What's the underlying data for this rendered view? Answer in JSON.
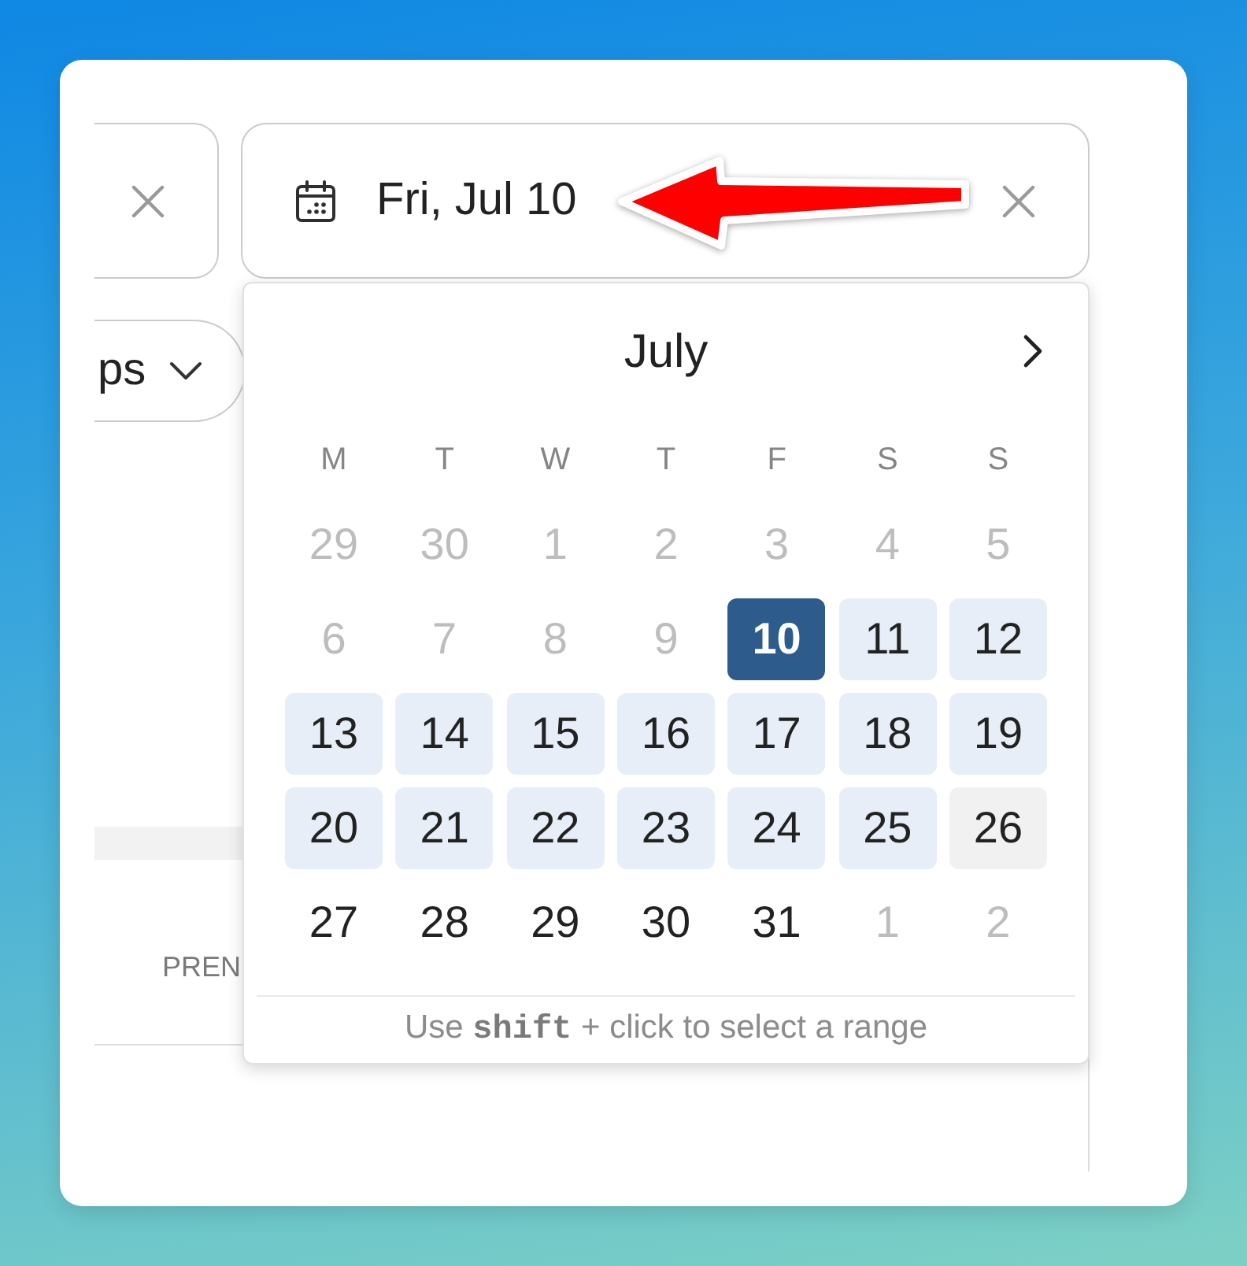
{
  "filters": [
    {
      "kind": "clipped",
      "clearable": true
    },
    {
      "kind": "date",
      "value": "Fri, Jul 10",
      "clearable": true
    }
  ],
  "date_picker": {
    "month": "July",
    "weekdays": [
      "M",
      "T",
      "W",
      "T",
      "F",
      "S",
      "S"
    ],
    "days": [
      {
        "label": "29",
        "disabled": true,
        "selected": false,
        "in_range": false,
        "hovered": false
      },
      {
        "label": "30",
        "disabled": true,
        "selected": false,
        "in_range": false,
        "hovered": false
      },
      {
        "label": "1",
        "disabled": true,
        "selected": false,
        "in_range": false,
        "hovered": false
      },
      {
        "label": "2",
        "disabled": true,
        "selected": false,
        "in_range": false,
        "hovered": false
      },
      {
        "label": "3",
        "disabled": true,
        "selected": false,
        "in_range": false,
        "hovered": false
      },
      {
        "label": "4",
        "disabled": true,
        "selected": false,
        "in_range": false,
        "hovered": false
      },
      {
        "label": "5",
        "disabled": true,
        "selected": false,
        "in_range": false,
        "hovered": false
      },
      {
        "label": "6",
        "disabled": true,
        "selected": false,
        "in_range": false,
        "hovered": false
      },
      {
        "label": "7",
        "disabled": true,
        "selected": false,
        "in_range": false,
        "hovered": false
      },
      {
        "label": "8",
        "disabled": true,
        "selected": false,
        "in_range": false,
        "hovered": false
      },
      {
        "label": "9",
        "disabled": true,
        "selected": false,
        "in_range": false,
        "hovered": false
      },
      {
        "label": "10",
        "disabled": false,
        "selected": true,
        "in_range": false,
        "hovered": false
      },
      {
        "label": "11",
        "disabled": false,
        "selected": false,
        "in_range": true,
        "hovered": false
      },
      {
        "label": "12",
        "disabled": false,
        "selected": false,
        "in_range": true,
        "hovered": false
      },
      {
        "label": "13",
        "disabled": false,
        "selected": false,
        "in_range": true,
        "hovered": false
      },
      {
        "label": "14",
        "disabled": false,
        "selected": false,
        "in_range": true,
        "hovered": false
      },
      {
        "label": "15",
        "disabled": false,
        "selected": false,
        "in_range": true,
        "hovered": false
      },
      {
        "label": "16",
        "disabled": false,
        "selected": false,
        "in_range": true,
        "hovered": false
      },
      {
        "label": "17",
        "disabled": false,
        "selected": false,
        "in_range": true,
        "hovered": false
      },
      {
        "label": "18",
        "disabled": false,
        "selected": false,
        "in_range": true,
        "hovered": false
      },
      {
        "label": "19",
        "disabled": false,
        "selected": false,
        "in_range": true,
        "hovered": false
      },
      {
        "label": "20",
        "disabled": false,
        "selected": false,
        "in_range": true,
        "hovered": false
      },
      {
        "label": "21",
        "disabled": false,
        "selected": false,
        "in_range": true,
        "hovered": false
      },
      {
        "label": "22",
        "disabled": false,
        "selected": false,
        "in_range": true,
        "hovered": false
      },
      {
        "label": "23",
        "disabled": false,
        "selected": false,
        "in_range": true,
        "hovered": false
      },
      {
        "label": "24",
        "disabled": false,
        "selected": false,
        "in_range": true,
        "hovered": false
      },
      {
        "label": "25",
        "disabled": false,
        "selected": false,
        "in_range": true,
        "hovered": false
      },
      {
        "label": "26",
        "disabled": false,
        "selected": false,
        "in_range": false,
        "hovered": true
      },
      {
        "label": "27",
        "disabled": false,
        "selected": false,
        "in_range": false,
        "hovered": false
      },
      {
        "label": "28",
        "disabled": false,
        "selected": false,
        "in_range": false,
        "hovered": false
      },
      {
        "label": "29",
        "disabled": false,
        "selected": false,
        "in_range": false,
        "hovered": false
      },
      {
        "label": "30",
        "disabled": false,
        "selected": false,
        "in_range": false,
        "hovered": false
      },
      {
        "label": "31",
        "disabled": false,
        "selected": false,
        "in_range": false,
        "hovered": false
      },
      {
        "label": "1",
        "disabled": true,
        "selected": false,
        "in_range": false,
        "hovered": false
      },
      {
        "label": "2",
        "disabled": true,
        "selected": false,
        "in_range": false,
        "hovered": false
      }
    ],
    "hint": "Use **shift** + click to select a range"
  },
  "dropdown": {
    "value": "ps"
  },
  "table": {
    "columns": [
      "PREN"
    ]
  },
  "annotation": {
    "kind": "arrow"
  }
}
